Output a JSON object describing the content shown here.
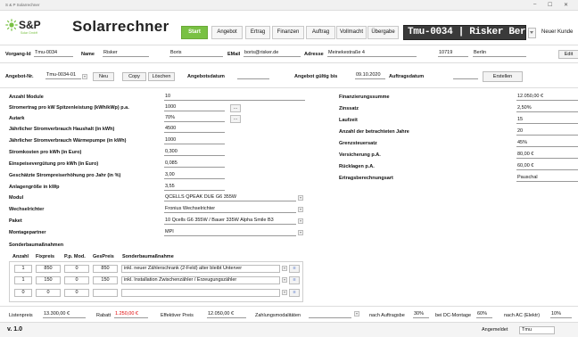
{
  "window": {
    "title": "S & P Solarrechner",
    "controls": [
      "–",
      "☐",
      "✕"
    ]
  },
  "brand": {
    "logo_text": "S&P",
    "tagline": "Solar GmbH",
    "app_title": "Solarrechner"
  },
  "tabs": [
    "Start",
    "Angebot",
    "Ertrag",
    "Finanzen",
    "Auftrag",
    "Vollmacht",
    "Übergabe"
  ],
  "project_banner": "Tmu-0034 | Risker Berlin",
  "new_customer_button": "Neuer Kunde",
  "customer": {
    "vorgang_label": "Vorgang-Id",
    "vorgang_value": "Tmu-0034",
    "name_label": "Name",
    "name_value": "Risker",
    "firstname_value": "Boris",
    "email_label": "EMail",
    "email_value": "boris@risker.de",
    "address_label": "Adresse",
    "address_value": "Meinekestraße 4",
    "zip_value": "10719",
    "city_value": "Berlin",
    "edit_button": "Edit"
  },
  "offer_bar": {
    "nr_label": "Angebot-Nr.",
    "nr_value": "Tmu-0034-01",
    "new_button": "Neu",
    "copy_button": "Copy",
    "delete_button": "Löschen",
    "date_label": "Angebotsdatum",
    "date_value": "",
    "valid_label": "Angebot gültig bis",
    "valid_value": "09.10.2020",
    "order_date_label": "Auftragsdatum",
    "order_date_value": "",
    "create_button": "Erstellen"
  },
  "left_fields": [
    {
      "label": "Anzahl Module",
      "value": "10"
    },
    {
      "label": "Stromertrag pro kW Spitzenleistung (kWh/kWp) p.a.",
      "value": "1000",
      "button": "..."
    },
    {
      "label": "Autark",
      "value": "70%",
      "button": "..."
    },
    {
      "label": "Jährlicher Stromverbrauch Haushalt (in kWh)",
      "value": "4500"
    },
    {
      "label": "Jährlicher Stromverbrauch Wärmepumpe (in kWh)",
      "value": "1000"
    },
    {
      "label": "Stromkosten pro kWh (in Euro)",
      "value": "0,300"
    },
    {
      "label": "Einspeisevergütung pro kWh (in Euro)",
      "value": "0,085"
    },
    {
      "label": "Geschätzte Strompreiserhöhung pro Jahr (in %)",
      "value": "3,00"
    },
    {
      "label": "Anlagengröße in kWp",
      "value": "3,55"
    },
    {
      "label": "Modul",
      "value": "QCELLS QPEAK DUE G6 355W"
    },
    {
      "label": "Wechselrichter",
      "value": "Fronius Wechselrichter"
    },
    {
      "label": "Paket",
      "value": "10 Qcells G6 355W / Bauer 335W Alpha Smile B3"
    },
    {
      "label": "Montagepartner",
      "value": "MPI"
    }
  ],
  "special": {
    "title": "Sonderbaumaßnahmen",
    "headers": [
      "Anzahl",
      "Fixpreis",
      "P.p. Mod.",
      "GesPreis",
      "Sonderbaumaßnahme"
    ],
    "rows": [
      {
        "count": "1",
        "fix": "850",
        "pp": "0",
        "total": "850",
        "desc": "inkl. neuer Zählerschrank (2-Feld) alter bleibt Unterver"
      },
      {
        "count": "1",
        "fix": "150",
        "pp": "0",
        "total": "150",
        "desc": "inkl. Installation Zwischenzähler / Erzeugungszähler"
      },
      {
        "count": "0",
        "fix": "0",
        "pp": "0",
        "total": "",
        "desc": ""
      }
    ],
    "row_button": "≡"
  },
  "right_fields": [
    {
      "label": "Finanzierungssumme",
      "value": "12.050,00 €"
    },
    {
      "label": "Zinssatz",
      "value": "2,50%"
    },
    {
      "label": "Laufzeit",
      "value": "15"
    },
    {
      "label": "Anzahl der betrachteten Jahre",
      "value": "20"
    },
    {
      "label": "Grenzsteuersatz",
      "value": "45%"
    },
    {
      "label": "Versicherung p.A.",
      "value": "80,00 €"
    },
    {
      "label": "Rücklagen p.A.",
      "value": "60,00 €"
    },
    {
      "label": "Ertragsberechnungsart",
      "value": "Pauschal"
    }
  ],
  "footer": {
    "list_label": "Listenpreis",
    "list_value": "13.300,00 €",
    "rebate_label": "Rabatt",
    "rebate_value": "1.250,00 €",
    "eff_label": "Effektiver Preis",
    "eff_value": "12.050,00 €",
    "pay_label": "Zahlungsmodalitäten",
    "pay_value": "",
    "ab_label": "nach Auftragsbe",
    "ab_value": "30%",
    "montage_label": "bei DC-Montage",
    "montage_value": "60%",
    "ac_label": "nach AC (Elektr)",
    "ac_value": "10%"
  },
  "status": {
    "version": "v. 1.0",
    "logged_label": "Angemeldet",
    "user": "Tmu"
  },
  "colors": {
    "accent_green": "#79c143",
    "banner_bg": "#3a3a3a",
    "rebate_red": "#e00000"
  }
}
